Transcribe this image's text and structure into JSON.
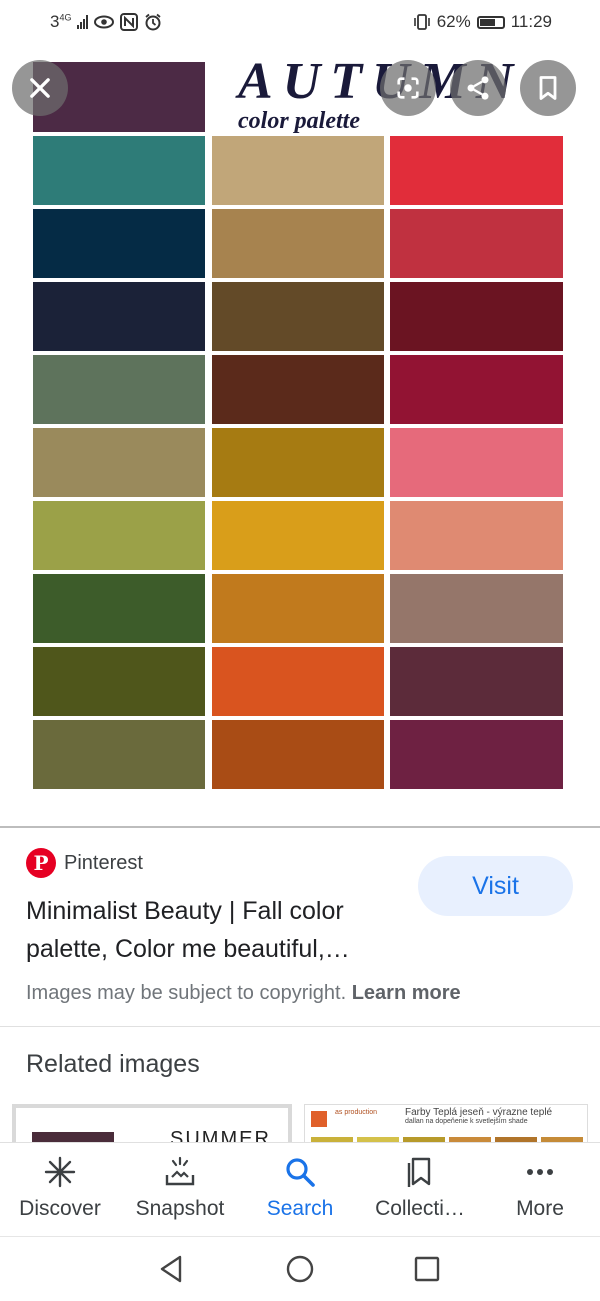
{
  "status_bar": {
    "network": "3",
    "network_sub": "4G",
    "battery": "62%",
    "time": "11:29"
  },
  "viewer": {
    "image": {
      "title": "AUTUMN",
      "subtitle": "color palette",
      "header_swatch": "#4c2a45",
      "columns": [
        [
          "#2e7c78",
          "#052b45",
          "#1b2238",
          "#5e735c",
          "#9a8a5c",
          "#9ba148",
          "#3d5c2a",
          "#4f561b",
          "#6a6a3c"
        ],
        [
          "#c1a679",
          "#a7834f",
          "#634a28",
          "#5b2a1b",
          "#a67b12",
          "#d99e1a",
          "#c17a1d",
          "#d9541f",
          "#a94c15"
        ],
        [
          "#e12d3a",
          "#c03140",
          "#6b1422",
          "#921333",
          "#e66a7b",
          "#df8a72",
          "#95766a",
          "#5c2b3a",
          "#6e2142"
        ]
      ]
    },
    "buttons": [
      "close-icon",
      "lens-icon",
      "share-icon",
      "bookmark-icon"
    ]
  },
  "result": {
    "source": "Pinterest",
    "title": "Minimalist Beauty | Fall color palette, Color me beautiful,…",
    "visit_label": "Visit",
    "copyright_text": "Images may be subject to copyright.",
    "learn_more": "Learn more"
  },
  "related": {
    "heading": "Related images",
    "thumb1_text": "SUMMER",
    "thumb2_brand": "as production",
    "thumb2_title": "Farby Teplá jeseň - výrazne teplé",
    "thumb2_sub": "dallan na dopeňenie k svetlejším shade",
    "thumb2_chips": [
      "#c9b13a",
      "#d4c14a",
      "#b79a2a",
      "#c98a3a",
      "#b0742a",
      "#c58b38"
    ]
  },
  "bottom_nav": [
    {
      "label": "Discover",
      "icon": "discover-icon",
      "active": false
    },
    {
      "label": "Snapshot",
      "icon": "snapshot-icon",
      "active": false
    },
    {
      "label": "Search",
      "icon": "search-icon",
      "active": true
    },
    {
      "label": "Collecti…",
      "icon": "collections-icon",
      "active": false
    },
    {
      "label": "More",
      "icon": "more-icon",
      "active": false
    }
  ],
  "colors": {
    "accent": "#1a73e8",
    "pinterest": "#e60023",
    "visit_bg": "#e8f0fe"
  }
}
